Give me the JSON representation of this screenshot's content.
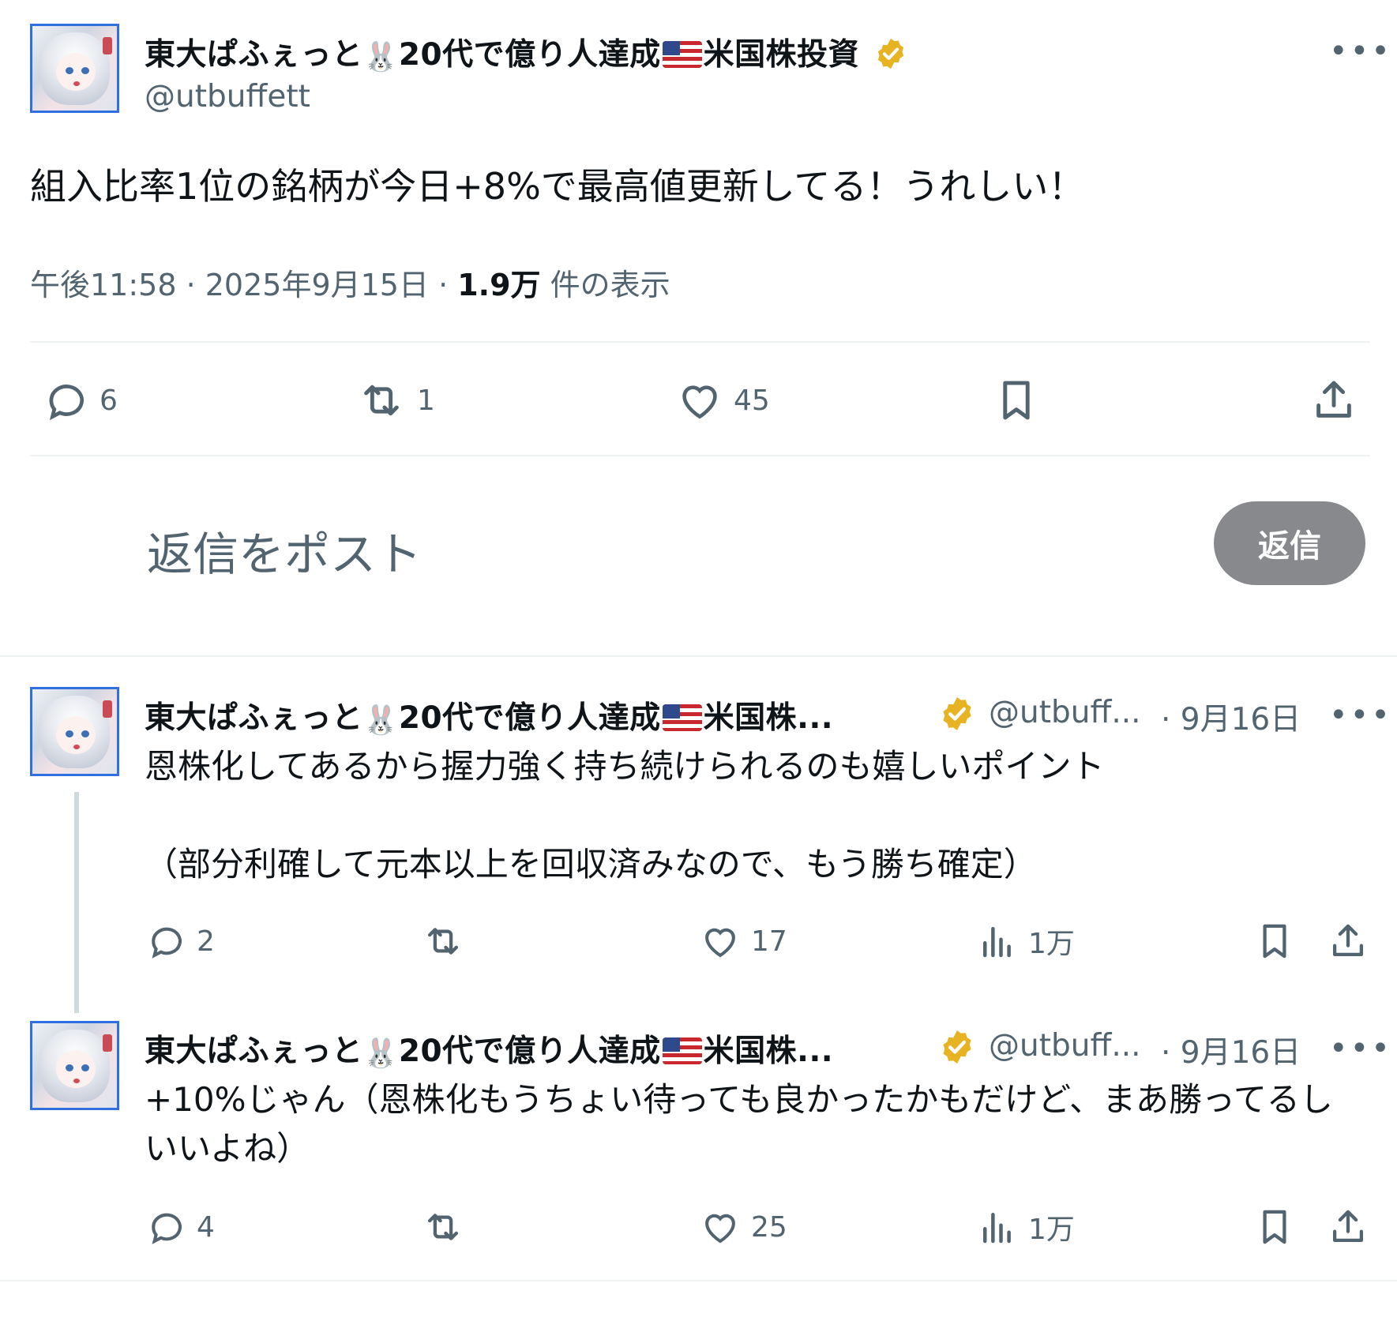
{
  "main_post": {
    "display_name": "東大ぱふぇっと",
    "name_mid": "20代で億り人達成",
    "name_end": "米国株投資",
    "handle": "@utbuffett",
    "text": "組入比率1位の銘柄が今日+8%で最高値更新してる！うれしい！",
    "time": "午後11:58 · 2025年9月15日 · ",
    "views_count": "1.9万",
    "views_label": " 件の表示",
    "replies": "6",
    "reposts": "1",
    "likes": "45"
  },
  "reply_box": {
    "placeholder": "返信をポスト",
    "button": "返信"
  },
  "replies": [
    {
      "display_name": "東大ぱふぇっと",
      "name_mid": "20代で億り人達成",
      "name_end": "米国株...",
      "handle": "@utbuff...",
      "date": "· 9月16日",
      "text": "恩株化してあるから握力強く持ち続けられるのも嬉しいポイント\n\n（部分利確して元本以上を回収済みなので、もう勝ち確定）",
      "replies": "2",
      "reposts": "",
      "likes": "17",
      "views": "1万"
    },
    {
      "display_name": "東大ぱふぇっと",
      "name_mid": "20代で億り人達成",
      "name_end": "米国株...",
      "handle": "@utbuff...",
      "date": "· 9月16日",
      "text": "+10%じゃん（恩株化もうちょい待っても良かったかもだけど、まあ勝ってるしいいよね）",
      "replies": "4",
      "reposts": "",
      "likes": "25",
      "views": "1万"
    }
  ],
  "colors": {
    "text": "#0f1419",
    "secondary": "#536471",
    "reply_button": "#87898c",
    "verified": "#e8b322",
    "avatar_border": "#2f6fe0"
  },
  "icons": [
    "reply-icon",
    "repost-icon",
    "like-icon",
    "views-icon",
    "bookmark-icon",
    "share-icon",
    "more-icon",
    "verified-icon",
    "flag-icon",
    "bunny-icon"
  ]
}
